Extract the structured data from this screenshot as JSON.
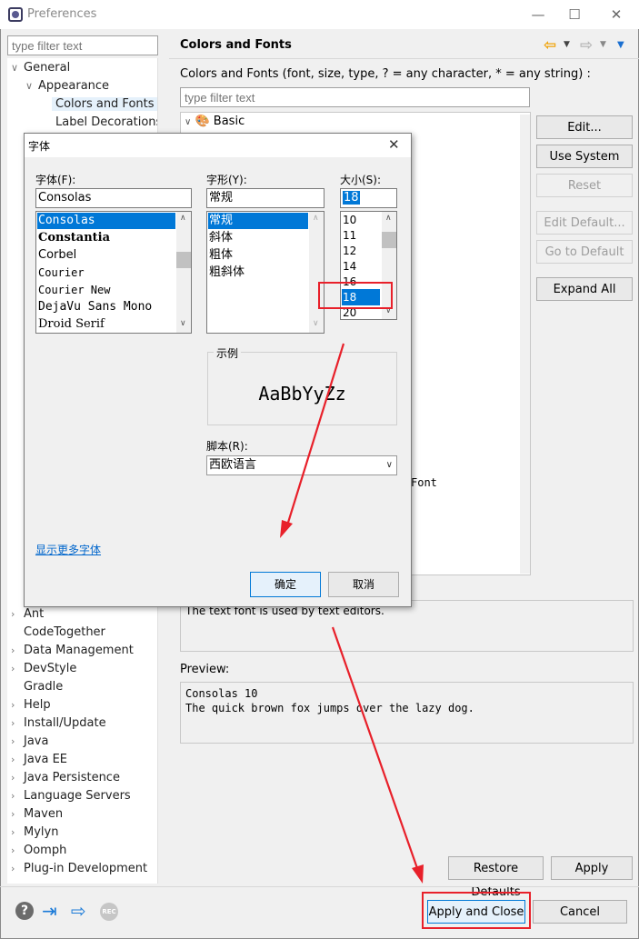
{
  "window": {
    "title": "Preferences",
    "minimize": "—",
    "maximize": "☐",
    "close": "✕"
  },
  "filter": {
    "placeholder": "type filter text"
  },
  "tree": {
    "top_items": [
      {
        "label": "General",
        "expanded": true
      },
      {
        "label": "Appearance",
        "expanded": true
      },
      {
        "label": "Colors and Fonts",
        "selected": true
      },
      {
        "label": "Label Decorations"
      }
    ],
    "bottom_items": [
      "Ant",
      "CodeTogether",
      "Data Management",
      "DevStyle",
      "Gradle",
      "Help",
      "Install/Update",
      "Java",
      "Java EE",
      "Java Persistence",
      "Language Servers",
      "Maven",
      "Mylyn",
      "Oomph",
      "Plug-in Development"
    ],
    "bottom_has_arrow": [
      true,
      false,
      true,
      true,
      false,
      true,
      true,
      true,
      true,
      true,
      true,
      true,
      true,
      true,
      true
    ]
  },
  "page": {
    "title": "Colors and Fonts",
    "description": "Colors and Fonts (font, size, type, ? = any character, * = any string) :",
    "filter_placeholder": "type filter text",
    "tree_root": "Basic",
    "partial_text": "Font",
    "buttons": {
      "edit": "Edit...",
      "use_system_font": "Use System Font",
      "reset": "Reset",
      "edit_default": "Edit Default...",
      "go_to_default": "Go to Default",
      "expand_all": "Expand All"
    },
    "description_text": "The text font is used by text editors.",
    "preview_label": "Preview:",
    "preview_line1": "Consolas 10",
    "preview_line2": "The quick brown fox jumps over the lazy dog.",
    "restore_defaults": "Restore Defaults",
    "apply": "Apply"
  },
  "footer": {
    "apply_and_close": "Apply and Close",
    "cancel": "Cancel",
    "rec": "REC"
  },
  "font_dialog": {
    "title": "字体",
    "close": "✕",
    "font_label": "字体(F):",
    "font_value": "Consolas",
    "fonts": [
      "Consolas",
      "Constantia",
      "Corbel",
      "Courier",
      "Courier New",
      "DejaVu Sans Mono",
      "Droid Serif"
    ],
    "style_label": "字形(Y):",
    "style_value": "常规",
    "styles": [
      "常规",
      "斜体",
      "粗体",
      "粗斜体"
    ],
    "size_label": "大小(S):",
    "size_value": "18",
    "sizes": [
      "10",
      "11",
      "12",
      "14",
      "16",
      "18",
      "20"
    ],
    "sample_label": "示例",
    "sample_text": "AaBbYyZz",
    "script_label": "脚本(R):",
    "script_value": "西欧语言",
    "more_fonts": "显示更多字体",
    "ok": "确定",
    "cancel": "取消"
  },
  "colors": {
    "accent": "#0078d7",
    "annotation": "#e8202a",
    "link": "#0066cc",
    "nav_arrow": "#f0a30a"
  }
}
